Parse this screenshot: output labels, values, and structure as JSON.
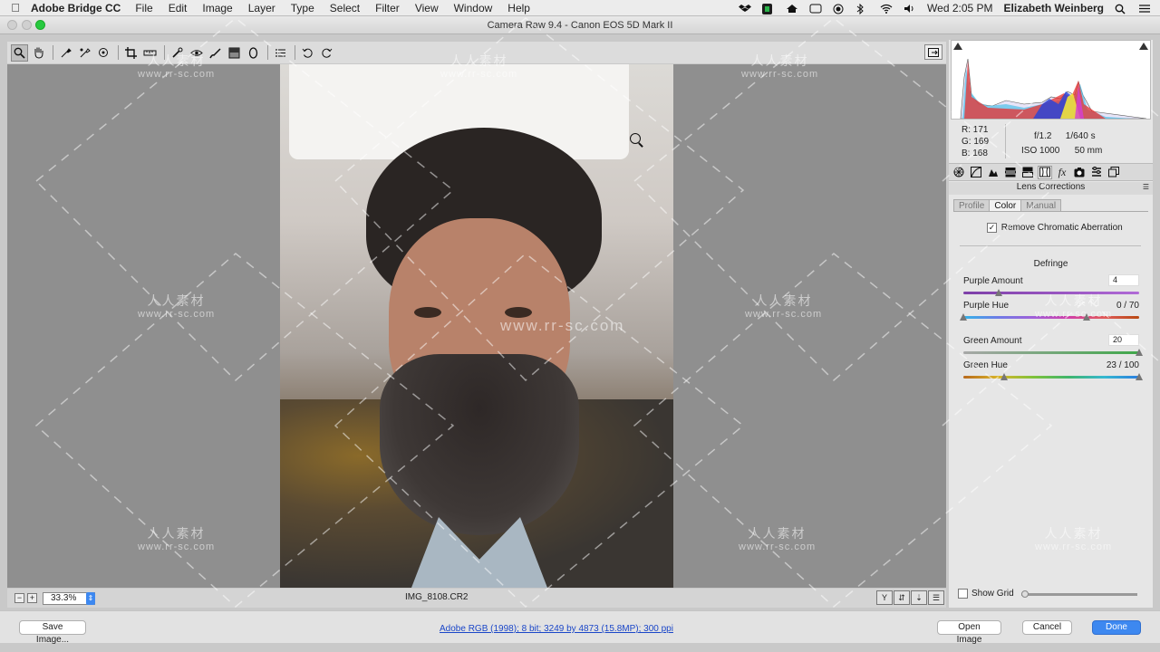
{
  "menubar": {
    "app_name": "Adobe Bridge CC",
    "items": [
      "File",
      "Edit",
      "Image",
      "Layer",
      "Type",
      "Select",
      "Filter",
      "View",
      "Window",
      "Help"
    ],
    "clock": "Wed 2:05 PM",
    "user": "Elizabeth Weinberg"
  },
  "window": {
    "title": "Camera Raw 9.4  -  Canon EOS 5D Mark II"
  },
  "toolbar": {
    "tools": [
      {
        "name": "zoom-tool",
        "glyph": "⚲"
      },
      {
        "name": "hand-tool",
        "glyph": "✋"
      },
      {
        "name": "white-balance-tool",
        "glyph": "✎"
      },
      {
        "name": "color-sampler-tool",
        "glyph": "✑"
      },
      {
        "name": "targeted-adjustment-tool",
        "glyph": "◎"
      },
      {
        "name": "crop-tool",
        "glyph": "⌗"
      },
      {
        "name": "straighten-tool",
        "glyph": "▭"
      },
      {
        "name": "spot-removal-tool",
        "glyph": "✤"
      },
      {
        "name": "red-eye-tool",
        "glyph": "◉"
      },
      {
        "name": "adjustment-brush-tool",
        "glyph": "✏"
      },
      {
        "name": "graduated-filter-tool",
        "glyph": "▣"
      },
      {
        "name": "radial-filter-tool",
        "glyph": "◯"
      },
      {
        "name": "preferences-tool",
        "glyph": "☰"
      },
      {
        "name": "rotate-ccw-tool",
        "glyph": "↺"
      },
      {
        "name": "rotate-cw-tool",
        "glyph": "↻"
      }
    ]
  },
  "status": {
    "zoom": "33.3%",
    "filename": "IMG_8108.CR2"
  },
  "readout": {
    "r": "R:  171",
    "g": "G:  169",
    "b": "B:  168",
    "aperture": "f/1.2",
    "shutter": "1/640 s",
    "iso": "ISO 1000",
    "focal": "50 mm"
  },
  "panel": {
    "tabs": [
      "basic",
      "tone-curve",
      "detail",
      "hsl",
      "split-toning",
      "lens-corrections",
      "effects",
      "camera-calibration",
      "presets",
      "snapshots"
    ],
    "active_tab_index": 5,
    "title": "Lens Corrections",
    "subtabs": [
      "Profile",
      "Color",
      "Manual"
    ],
    "active_subtab": "Color",
    "chromatic_label": "Remove Chromatic Aberration",
    "chromatic_checked": true,
    "defringe_title": "Defringe",
    "purple_amount_label": "Purple Amount",
    "purple_amount_value": "4",
    "purple_amount": 4,
    "purple_hue_label": "Purple Hue",
    "purple_hue_value": "0 / 70",
    "purple_hue": [
      0,
      70
    ],
    "green_amount_label": "Green Amount",
    "green_amount_value": "20",
    "green_amount": 20,
    "green_hue_label": "Green Hue",
    "green_hue_value": "23 / 100",
    "green_hue": [
      23,
      100
    ],
    "show_grid_label": "Show Grid",
    "show_grid_checked": false
  },
  "bottom": {
    "save_label": "Save Image...",
    "workflow_link": "Adobe RGB (1998); 8 bit; 3249 by 4873 (15.8MP); 300 ppi",
    "open_label": "Open Image",
    "cancel_label": "Cancel",
    "done_label": "Done"
  },
  "watermark": {
    "cn": "人人素材",
    "url": "www.rr-sc.com"
  },
  "colors": {
    "accent": "#3d88f0",
    "link": "#1a46c8",
    "purple_track": "#9b4fc8",
    "green_track": "#3fa84a"
  }
}
